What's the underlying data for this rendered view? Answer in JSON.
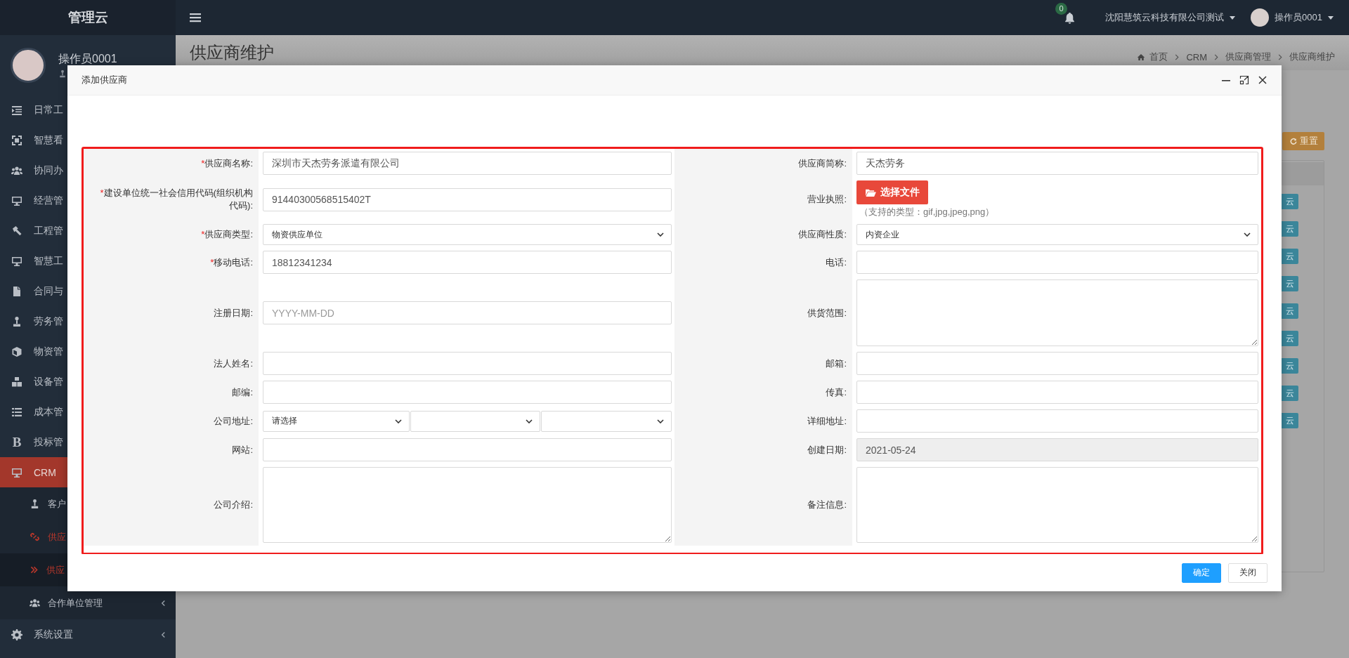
{
  "app": {
    "logo": "管理云",
    "user": "操作员0001"
  },
  "sidebar": {
    "items": [
      {
        "label": "日常工",
        "selected": false
      },
      {
        "label": "智慧看",
        "selected": false
      },
      {
        "label": "协同办",
        "selected": false
      },
      {
        "label": "经营管",
        "selected": false
      },
      {
        "label": "工程管",
        "selected": false
      },
      {
        "label": "智慧工",
        "selected": false
      },
      {
        "label": "合同与",
        "selected": false
      },
      {
        "label": "劳务管",
        "selected": false
      },
      {
        "label": "物资管",
        "selected": false
      },
      {
        "label": "设备管",
        "selected": false
      },
      {
        "label": "成本管",
        "selected": false
      },
      {
        "label": "投标管",
        "glyph": "B",
        "selected": false
      },
      {
        "label": "CRM",
        "selected": true,
        "children": [
          {
            "label": "客户",
            "selected": false
          },
          {
            "label": "供应",
            "selected": true,
            "children": [
              {
                "label": "供应",
                "selected": true
              }
            ]
          },
          {
            "label": "合作单位管理",
            "selected": false,
            "has_submenu": true
          }
        ]
      },
      {
        "label": "系统设置",
        "selected": false,
        "has_submenu": true
      }
    ]
  },
  "topbar": {
    "notifications": "0",
    "company": "沈阳慧筑云科技有限公司测试",
    "user": "操作员0001"
  },
  "page": {
    "title": "供应商维护",
    "breadcrumb": [
      "首页",
      "CRM",
      "供应商管理",
      "供应商维护"
    ],
    "reset_button": "重置",
    "row_actions": [
      "云",
      "云",
      "云",
      "云",
      "云",
      "云",
      "云",
      "云",
      "云"
    ]
  },
  "dialog": {
    "title": "添加供应商",
    "rows": [
      {
        "left": {
          "label": "供应商名称:",
          "mark": "*",
          "kind": "text",
          "value": "深圳市天杰劳务派遣有限公司",
          "disabled": false
        },
        "right": {
          "label": "供应商简称:",
          "kind": "text",
          "value": "天杰劳务",
          "disabled": false
        }
      },
      {
        "left": {
          "label": "建设单位统一社会信用代码(组织机构代码):",
          "mark": "*",
          "kind": "text",
          "value": "91440300568515402T",
          "disabled": false
        },
        "right": {
          "label": "营业执照:",
          "kind": "file",
          "button": "选择文件",
          "hint": "（支持的类型：gif,jpg,jpeg,png）",
          "disabled": false
        }
      },
      {
        "left": {
          "label": "供应商类型:",
          "mark": "*",
          "kind": "select",
          "value": "物资供应单位",
          "disabled": false
        },
        "right": {
          "label": "供应商性质:",
          "kind": "select",
          "value": "内资企业",
          "disabled": false
        }
      },
      {
        "left": {
          "label": "移动电话:",
          "mark": "*",
          "kind": "text",
          "value": "18812341234",
          "disabled": false
        },
        "right": {
          "label": "电话:",
          "kind": "text",
          "disabled": false
        }
      },
      {
        "left": {
          "label": "注册日期:",
          "kind": "text",
          "placeholder": "YYYY-MM-DD",
          "disabled": false
        },
        "right": {
          "label": "供货范围:",
          "kind": "textarea",
          "disabled": false
        }
      },
      {
        "left": {
          "label": "法人姓名:",
          "kind": "text",
          "disabled": false
        },
        "right": {
          "label": "邮箱:",
          "kind": "text",
          "disabled": false
        }
      },
      {
        "left": {
          "label": "邮编:",
          "kind": "text",
          "disabled": false
        },
        "right": {
          "label": "传真:",
          "kind": "text",
          "disabled": false
        }
      },
      {
        "left": {
          "label": "公司地址:",
          "kind": "address",
          "selects": [
            {
              "kind": "select",
              "value": "请选择"
            },
            {
              "kind": "select"
            },
            {
              "kind": "select"
            }
          ],
          "disabled": false
        },
        "right": {
          "label": "详细地址:",
          "kind": "text",
          "disabled": false
        }
      },
      {
        "left": {
          "label": "网站:",
          "kind": "text",
          "disabled": false
        },
        "right": {
          "label": "创建日期:",
          "kind": "text",
          "value": "2021-05-24",
          "disabled": true
        }
      },
      {
        "left": {
          "label": "公司介绍:",
          "kind": "textarea",
          "disabled": false
        },
        "right": {
          "label": "备注信息:",
          "kind": "textarea",
          "disabled": false
        }
      }
    ],
    "buttons": [
      {
        "label": "确定",
        "kind": "primary"
      },
      {
        "label": "关闭",
        "kind": "default"
      }
    ]
  }
}
